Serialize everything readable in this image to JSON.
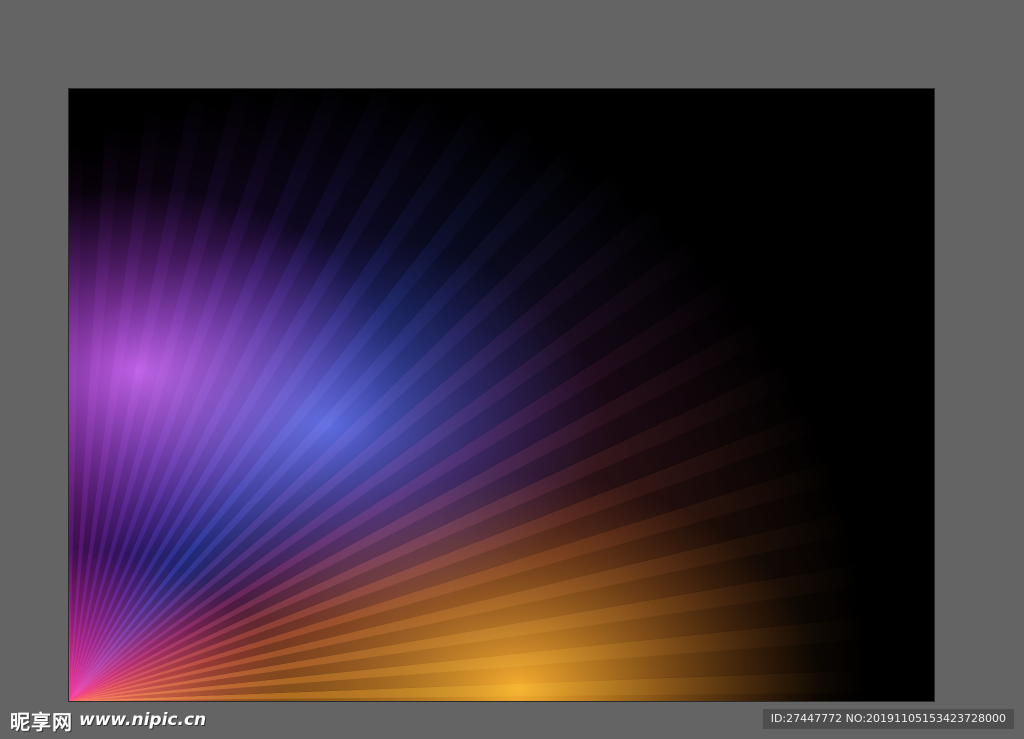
{
  "artwork": {
    "description_colors": {
      "violet": "#b347e0",
      "blue": "#3f5fd8",
      "red": "#ff2a55",
      "orange": "#ffa020",
      "background": "#000000",
      "workspace": "#646464"
    }
  },
  "watermark": {
    "site_name": "昵享网",
    "url": "www.nipic.cn"
  },
  "id_strip": {
    "text": "ID:27447772 NO:20191105153423728000"
  }
}
